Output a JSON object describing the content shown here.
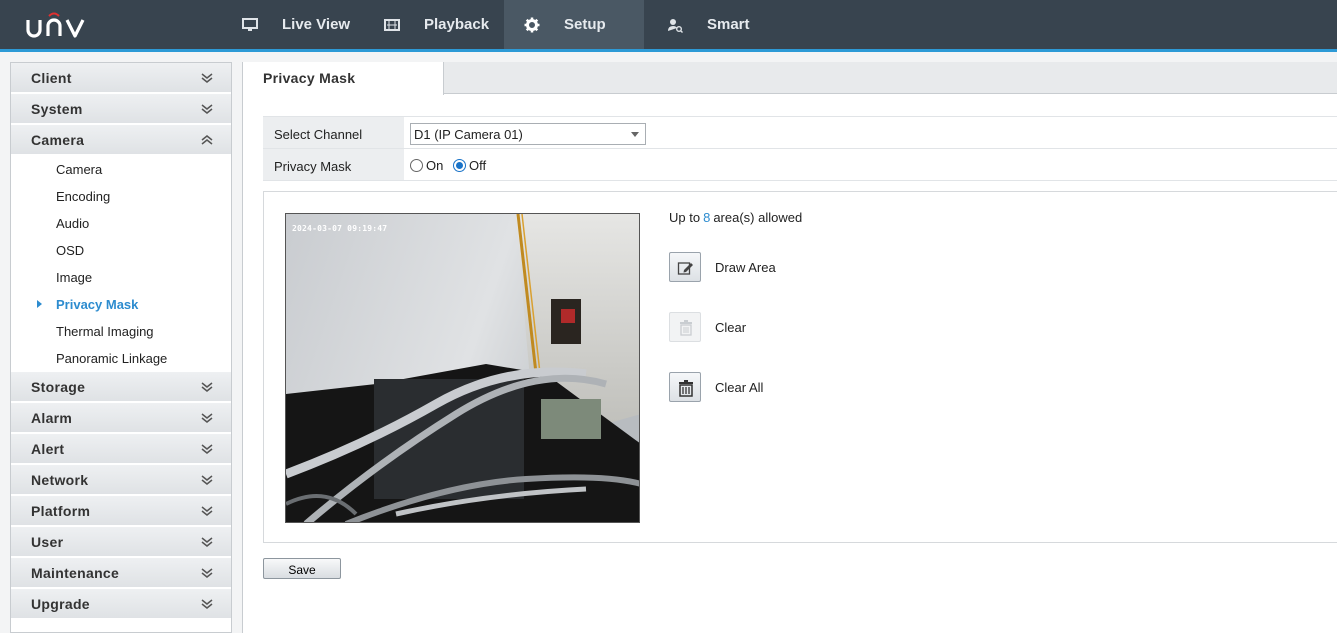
{
  "brand": {
    "logo_text": "UNV",
    "accent": "#2d9ad6"
  },
  "nav": [
    {
      "label": "Live View",
      "icon": "monitor-icon"
    },
    {
      "label": "Playback",
      "icon": "film-icon"
    },
    {
      "label": "Setup",
      "icon": "gear-icon",
      "active": true
    },
    {
      "label": "Smart",
      "icon": "smart-person-icon"
    }
  ],
  "sidebar": {
    "groups": {
      "client": "Client",
      "system": "System",
      "camera": "Camera",
      "storage": "Storage",
      "alarm": "Alarm",
      "alert": "Alert",
      "network": "Network",
      "platform": "Platform",
      "user": "User",
      "maintenance": "Maintenance",
      "upgrade": "Upgrade"
    },
    "camera_items": {
      "camera": "Camera",
      "encoding": "Encoding",
      "audio": "Audio",
      "osd": "OSD",
      "image": "Image",
      "privacy_mask": "Privacy Mask",
      "thermal_imaging": "Thermal Imaging",
      "panoramic_linkage": "Panoramic Linkage"
    },
    "active_item": "Privacy Mask"
  },
  "main": {
    "tab": "Privacy Mask",
    "select_channel_label": "Select Channel",
    "select_channel_value": "D1 (IP Camera 01)",
    "privacy_mask_label": "Privacy Mask",
    "radio_on": "On",
    "radio_off": "Off",
    "privacy_mask_state": "Off",
    "osd_timestamp": "2024-03-07 09:19:47",
    "areas_prefix": "Up to",
    "areas_count": "8",
    "areas_suffix": "area(s) allowed",
    "draw_area": "Draw Area",
    "clear": "Clear",
    "clear_all": "Clear All",
    "save": "Save"
  }
}
